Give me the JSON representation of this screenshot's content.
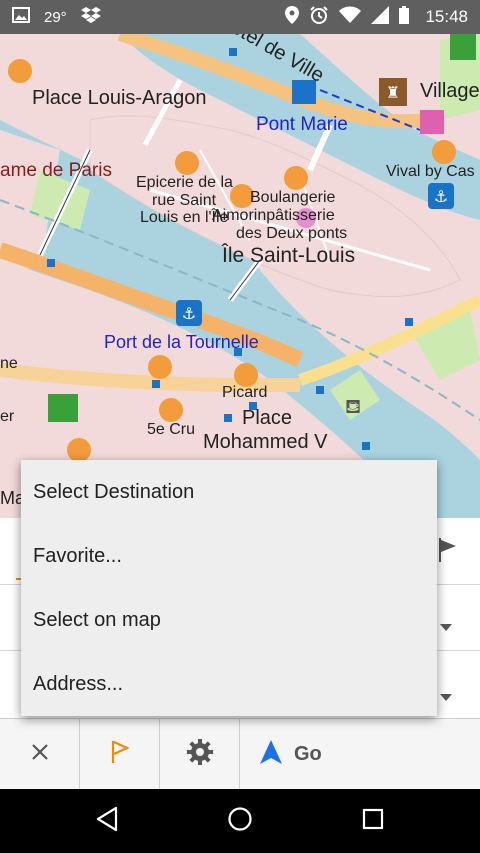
{
  "status_bar": {
    "temperature": "29°",
    "time": "15:48",
    "icons": [
      "image-icon",
      "dropbox-icon",
      "location-pin-icon",
      "alarm-icon",
      "wifi-icon",
      "signal-icon",
      "battery-icon"
    ]
  },
  "map": {
    "labels": {
      "hotel_de_ville": "Hôtel de Ville",
      "village": "Village",
      "place_louis_aragon": "Place Louis-Aragon",
      "pont_marie": "Pont Marie",
      "notre_dame": "ame de Paris",
      "vival": "Vival by Cas",
      "epicerie_1": "Epicerie de la",
      "epicerie_2": "rue Saint",
      "epicerie_3": "Louis en l'Île",
      "boulangerie_1": "Boulangerie",
      "boulangerie_2": "Aimorinpâtisserie",
      "boulangerie_3": "des Deux ponts",
      "ile_saint_louis": "Île Saint-Louis",
      "port_tournelle": "Port de la Tournelle",
      "ne": "ne",
      "er": "er",
      "picard": "Picard",
      "cinq_cru": "5e Cru",
      "place_mohammed_1": "Place",
      "place_mohammed_2": "Mohammed V",
      "ma": "Ma"
    },
    "colors": {
      "river": "#aad3df",
      "land": "#f2dada",
      "road": "#f5c37f",
      "park": "#cdebb0",
      "poi": "#f39c3c",
      "water_poi": "#1a73c9",
      "label_blue": "#2222cc",
      "label_red": "#8b1a1a"
    }
  },
  "menu": {
    "items": [
      {
        "label": "Select Destination"
      },
      {
        "label": "Favorite..."
      },
      {
        "label": "Select on map"
      },
      {
        "label": "Address..."
      }
    ]
  },
  "toolbar": {
    "go_label": "Go",
    "accent": "#f08a00",
    "nav_blue": "#1a73e8",
    "icons": [
      "close-icon",
      "flag-icon",
      "gear-icon",
      "navigation-arrow-icon"
    ]
  },
  "navbar": {
    "icons": [
      "back-icon",
      "home-icon",
      "recents-icon"
    ]
  }
}
